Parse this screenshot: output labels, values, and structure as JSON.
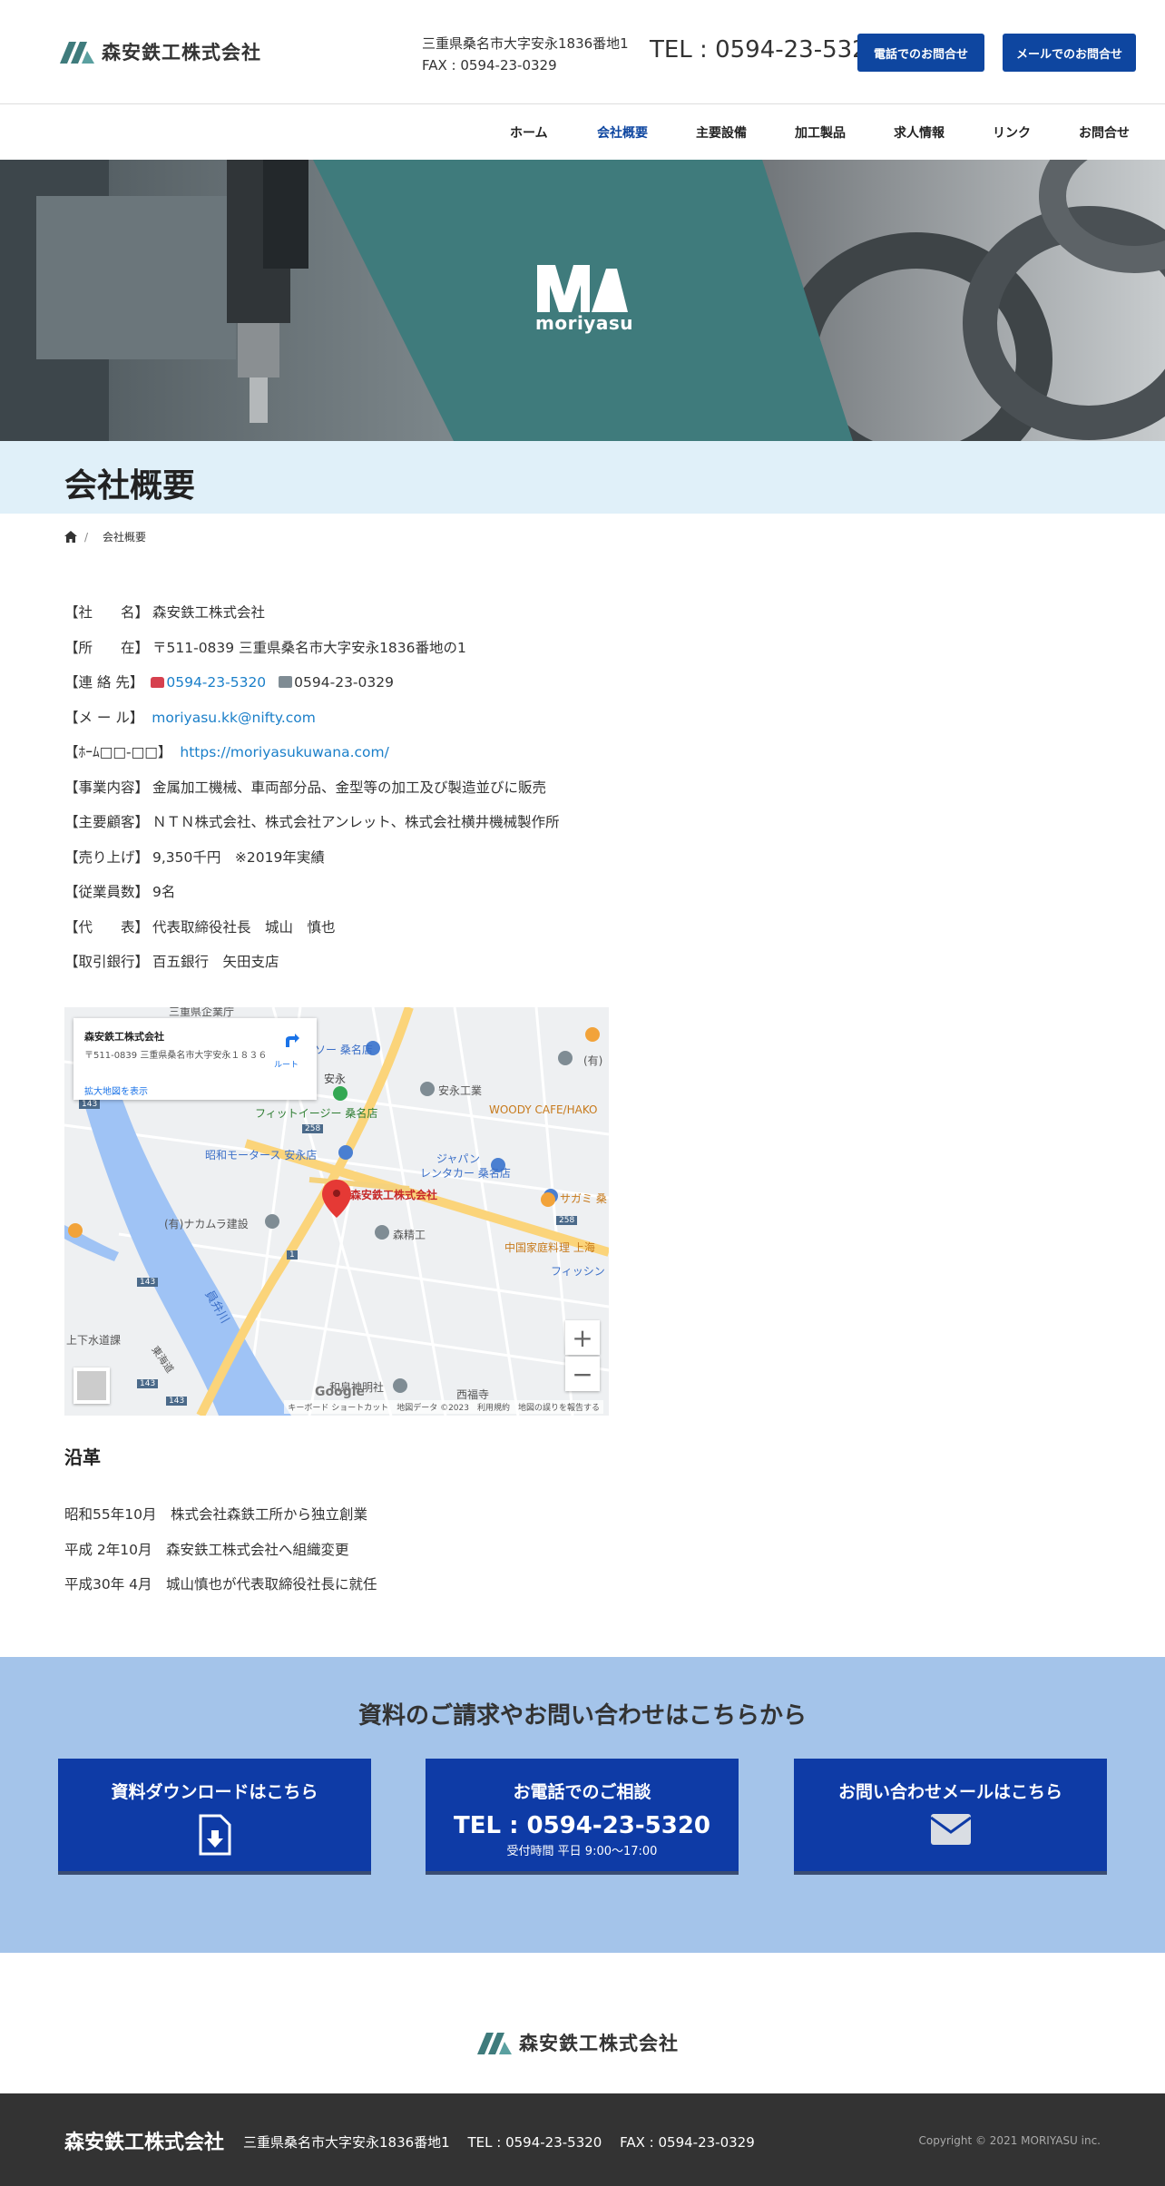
{
  "header": {
    "company_name": "森安鉄工株式会社",
    "address": "三重県桑名市大字安永1836番地1",
    "fax": "FAX : 0594-23-0329",
    "tel": "TEL : 0594-23-5320",
    "btn_phone": "電話でのお問合せ",
    "btn_mail": "メールでのお問合せ"
  },
  "nav": {
    "items": [
      "ホーム",
      "会社概要",
      "主要設備",
      "加工製品",
      "求人情報",
      "リンク",
      "お問合せ"
    ],
    "active": "会社概要"
  },
  "hero": {
    "brand": "moriyasu"
  },
  "page": {
    "title": "会社概要",
    "breadcrumb_current": "会社概要",
    "breadcrumb_sep": "/"
  },
  "info": {
    "rows": [
      {
        "label": "【社　　名】",
        "value": "森安鉄工株式会社"
      },
      {
        "label": "【所　　在】",
        "value": "〒511-0839 三重県桑名市大字安永1836番地の1"
      },
      {
        "label": "【連 絡 先】",
        "phone": "0594-23-5320",
        "fax": "0594-23-0329"
      },
      {
        "label": "【メ ー ル】",
        "link": "moriyasu.kk@nifty.com"
      },
      {
        "label": "【ﾎｰﾑ□□-□□】",
        "link": "https://moriyasukuwana.com/"
      },
      {
        "label": "【事業内容】",
        "value": "金属加工機械、車両部分品、金型等の加工及び製造並びに販売"
      },
      {
        "label": "【主要顧客】",
        "value": "ＮＴＮ株式会社、株式会社アンレット、株式会社横井機械製作所"
      },
      {
        "label": "【売り上げ】",
        "value": "9,350千円　※2019年実績"
      },
      {
        "label": "【従業員数】",
        "value": "9名"
      },
      {
        "label": "【代　　表】",
        "value": "代表取締役社長　城山　慎也"
      },
      {
        "label": "【取引銀行】",
        "value": "百五銀行　矢田支店"
      }
    ]
  },
  "map": {
    "card_name": "森安鉄工株式会社",
    "card_addr": "〒511-0839 三重県桑名市大字安永１８３６",
    "card_link": "拡大地図を表示",
    "directions": "ルート",
    "pin_label": "森安鉄工株式会社",
    "labels": [
      "三重県企業庁",
      "ナイソー 桑名店",
      "安永",
      "安永工業",
      "フィットイージー 桑名店",
      "WOODY CAFE/HAKO",
      "昭和モータース 安永店",
      "ジャパン",
      "レンタカー 桑名店",
      "サガミ 桑",
      "(有)ナカムラ建設",
      "森精工",
      "中国家庭料理 上海",
      "フィッシン",
      "員弁川",
      "上下水道課",
      "東海道",
      "和泉神明社",
      "西福寺",
      "(有)"
    ],
    "road_numbers": [
      "143",
      "258",
      "143",
      "258",
      "1",
      "143",
      "143"
    ],
    "zoom_in": "+",
    "zoom_out": "−",
    "google": "Google",
    "footer": "キーボード ショートカット　地図データ ©2023　利用規約　地図の誤りを報告する"
  },
  "history": {
    "title": "沿革",
    "rows": [
      "昭和55年10月　株式会社森鉄工所から独立創業",
      "平成 2年10月　森安鉄工株式会社へ組織変更",
      "平成30年 4月　城山慎也が代表取締役社長に就任"
    ]
  },
  "cta": {
    "title": "資料のご請求やお問い合わせはこちらから",
    "download": "資料ダウンロードはこちら",
    "phone_title": "お電話でのご相談",
    "phone_tel": "TEL : 0594-23-5320",
    "phone_hours": "受付時間 平日 9:00〜17:00",
    "mail": "お問い合わせメールはこちら"
  },
  "footer": {
    "company_name": "森安鉄工株式会社",
    "address_line": "三重県桑名市大字安永1836番地1　 TEL : 0594-23-5320　 FAX : 0594-23-0329",
    "copyright": "Copyright © 2021 MORIYASU inc."
  },
  "colors": {
    "brand": "#0e46a0",
    "teal": "#3f7b7c",
    "cta_bg": "#a4c4ea",
    "title_band": "#e0f0f9",
    "footer_bg": "#333333"
  }
}
